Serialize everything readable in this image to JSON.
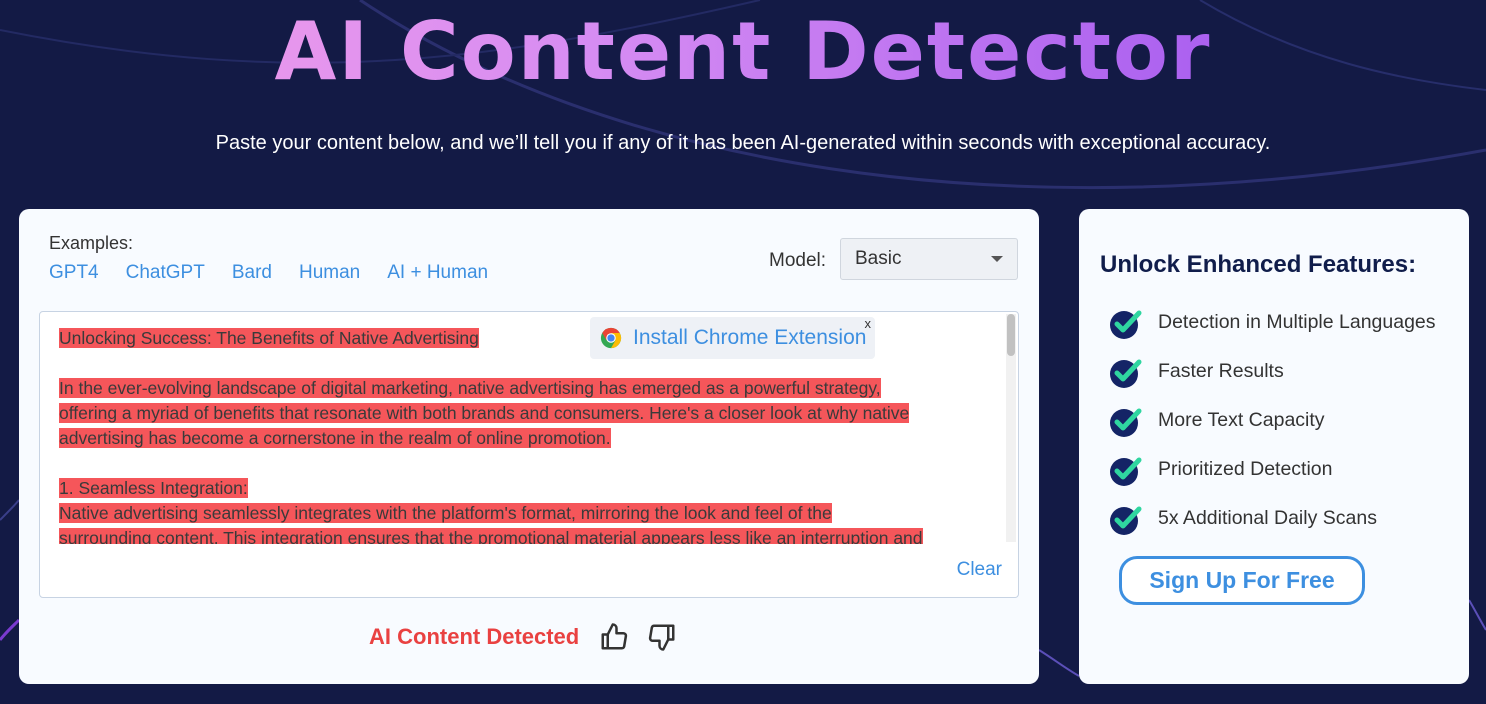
{
  "hero": {
    "title": "AI Content Detector",
    "subtitle": "Paste your content below, and we’ll tell you if any of it has been AI-generated within seconds with exceptional accuracy."
  },
  "examples": {
    "label": "Examples:",
    "links": [
      "GPT4",
      "ChatGPT",
      "Bard",
      "Human",
      "AI + Human"
    ]
  },
  "model": {
    "label": "Model:",
    "selected": "Basic"
  },
  "extension_banner": {
    "text": "Install Chrome Extension",
    "close": "x"
  },
  "content": {
    "paragraphs": [
      [
        "Unlocking Success: The Benefits of Native Advertising"
      ],
      [
        "In the ever-evolving landscape of digital marketing, native advertising has emerged as a powerful strategy,",
        "offering a myriad of benefits that resonate with both brands and consumers. Here's a closer look at why native",
        "advertising has become a cornerstone in the realm of online promotion."
      ],
      [
        "1. Seamless Integration:",
        "Native advertising seamlessly integrates with the platform's format, mirroring the look and feel of the",
        "surrounding content. This integration ensures that the promotional material appears less like an interruption and"
      ]
    ],
    "clear_label": "Clear"
  },
  "result": {
    "text": "AI Content Detected"
  },
  "features": {
    "title": "Unlock Enhanced Features:",
    "items": [
      "Detection in Multiple Languages",
      "Faster Results",
      "More Text Capacity",
      "Prioritized Detection",
      "5x Additional Daily Scans"
    ],
    "cta": "Sign Up For Free"
  },
  "colors": {
    "background": "#131a45",
    "accent": "#3d8fe0",
    "highlight": "#f5565a",
    "alert": "#e94141",
    "check": "#2fd6a0"
  }
}
